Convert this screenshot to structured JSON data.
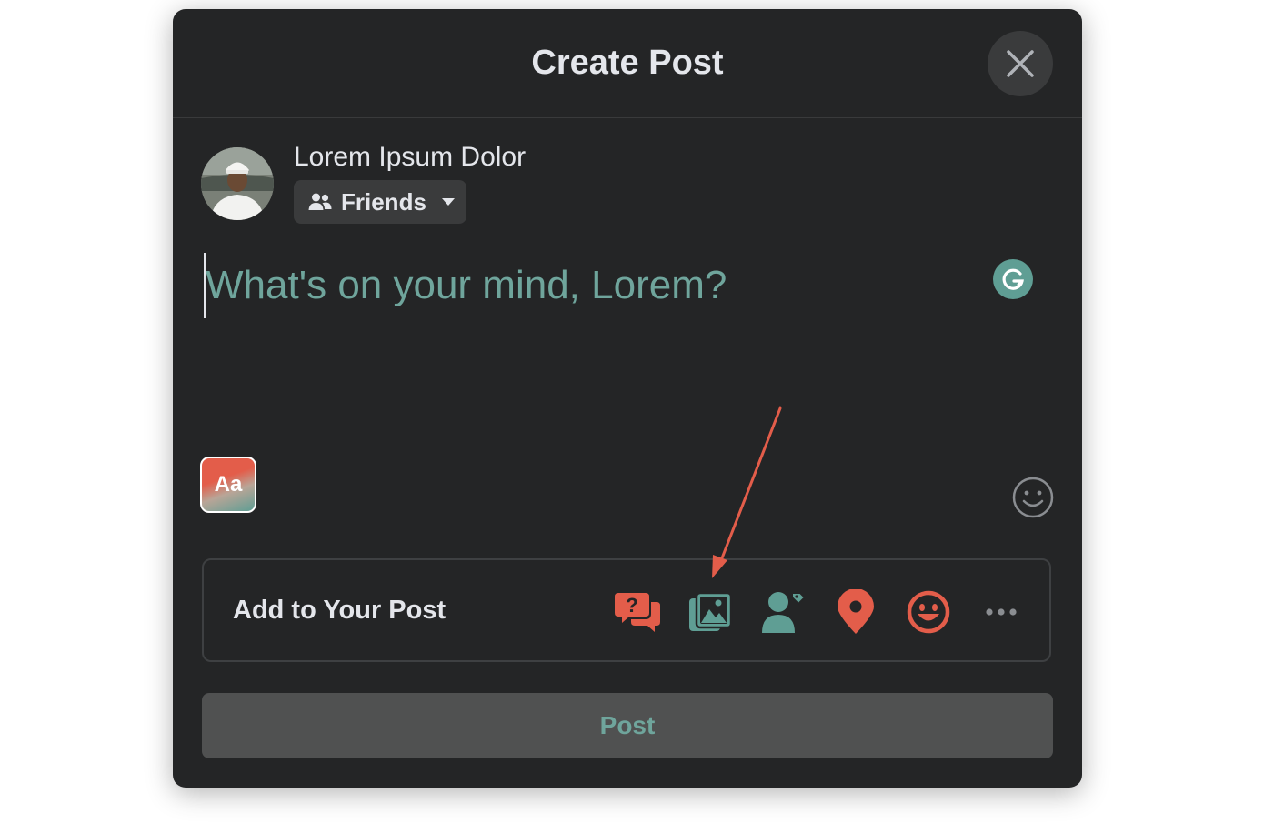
{
  "dialog": {
    "title": "Create Post",
    "close_icon": "close-icon"
  },
  "author": {
    "name": "Lorem Ipsum Dolor",
    "avatar": "user-avatar-photo",
    "audience": {
      "label": "Friends",
      "icon": "friends-icon",
      "dropdown_icon": "caret-down-icon"
    }
  },
  "composer": {
    "placeholder": "What's on your mind, Lorem?",
    "value": "",
    "grammarly_icon": "grammarly-icon"
  },
  "text_format": {
    "label": "Aa"
  },
  "add_to_post": {
    "label": "Add to Your Post",
    "tools": [
      {
        "icon": "question-chat-icon",
        "color": "#e35d4a"
      },
      {
        "icon": "photo-video-icon",
        "color": "#5f9e94"
      },
      {
        "icon": "tag-people-icon",
        "color": "#5f9e94"
      },
      {
        "icon": "location-pin-icon",
        "color": "#e35d4a"
      },
      {
        "icon": "feeling-emoji-icon",
        "color": "#e35d4a"
      },
      {
        "icon": "more-icon",
        "color": "#8a8d91"
      }
    ]
  },
  "post_button": {
    "label": "Post"
  },
  "colors": {
    "dialog_bg": "#242526",
    "accent_teal": "#5f9e94",
    "accent_coral": "#e35d4a",
    "text_primary": "#e4e6eb"
  }
}
